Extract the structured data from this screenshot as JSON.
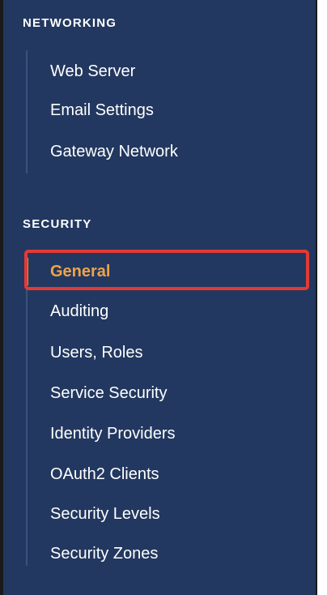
{
  "networking": {
    "title": "NETWORKING",
    "items": [
      {
        "label": "Web Server"
      },
      {
        "label": "Email Settings"
      },
      {
        "label": "Gateway Network"
      }
    ]
  },
  "security": {
    "title": "SECURITY",
    "items": [
      {
        "label": "General",
        "active": true
      },
      {
        "label": "Auditing"
      },
      {
        "label": "Users, Roles"
      },
      {
        "label": "Service Security"
      },
      {
        "label": "Identity Providers"
      },
      {
        "label": "OAuth2 Clients"
      },
      {
        "label": "Security Levels"
      },
      {
        "label": "Security Zones"
      }
    ]
  },
  "colors": {
    "sidebar_bg": "#223860",
    "active_text": "#f0a24a",
    "highlight_border": "#e53935"
  }
}
